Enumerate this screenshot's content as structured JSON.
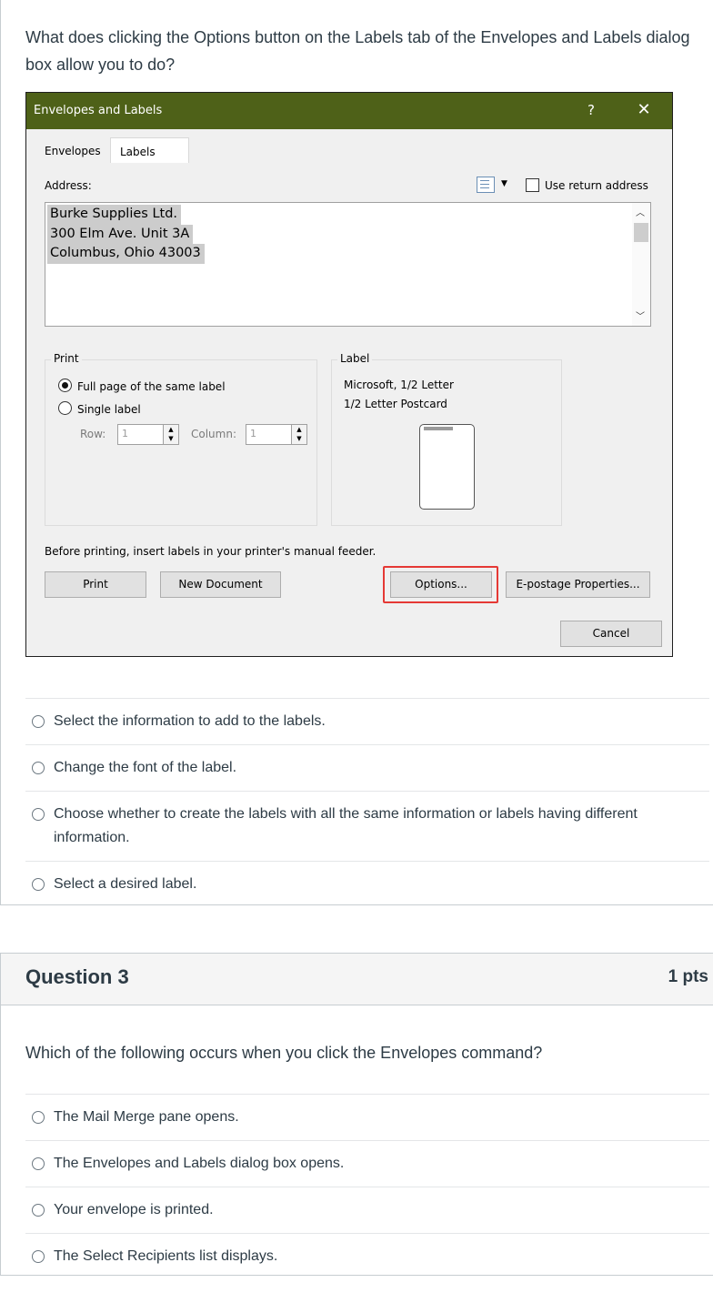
{
  "question2": {
    "text": "What does clicking the Options button on the Labels tab of the Envelopes and Labels dialog box allow you to do?",
    "dialog": {
      "title": "Envelopes and Labels",
      "help": "?",
      "close": "✕",
      "tabs": {
        "envelopes": "Envelopes",
        "labels": "Labels"
      },
      "address_label": "Address:",
      "use_return_address": "Use return address",
      "address_lines": [
        "Burke Supplies Ltd.",
        "300 Elm Ave. Unit 3A",
        "Columbus, Ohio  43003"
      ],
      "print_group": {
        "legend": "Print",
        "full_page": "Full page of the same label",
        "single_label": "Single label",
        "row_label": "Row:",
        "row_value": "1",
        "column_label": "Column:",
        "column_value": "1"
      },
      "label_group": {
        "legend": "Label",
        "vendor": "Microsoft, 1/2 Letter",
        "product": "1/2 Letter Postcard"
      },
      "hint": "Before printing, insert labels in your printer's manual feeder.",
      "buttons": {
        "print": "Print",
        "new_document": "New Document",
        "options": "Options...",
        "epostage": "E-postage Properties...",
        "cancel": "Cancel"
      }
    },
    "answers": [
      "Select the information to add to the labels.",
      "Change the font of the label.",
      "Choose whether to create the labels with all the same information or labels having different information.",
      "Select a desired label."
    ]
  },
  "question3": {
    "title": "Question 3",
    "points": "1 pts",
    "text": "Which of the following occurs when you click the Envelopes command?",
    "answers": [
      "The Mail Merge pane opens.",
      "The Envelopes and Labels dialog box opens.",
      "Your envelope is printed.",
      "The Select Recipients list displays."
    ]
  },
  "colors": {
    "title_bar": "#4e6118",
    "highlight_box": "#e53935",
    "text": "#2d3b45"
  }
}
